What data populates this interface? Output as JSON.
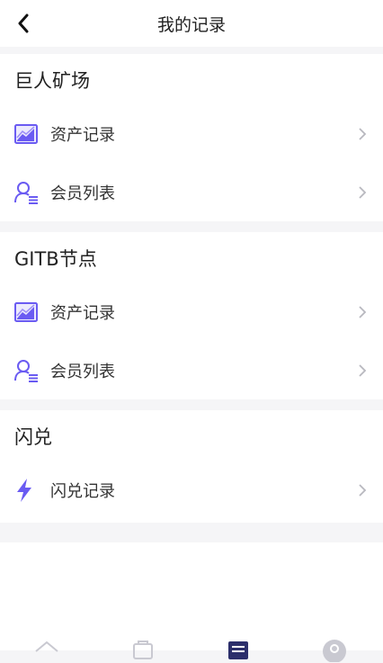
{
  "header": {
    "title": "我的记录"
  },
  "sections": [
    {
      "title": "巨人矿场",
      "items": [
        {
          "label": "资产记录",
          "icon": "chart-icon"
        },
        {
          "label": "会员列表",
          "icon": "member-list-icon"
        }
      ]
    },
    {
      "title": "GITB节点",
      "items": [
        {
          "label": "资产记录",
          "icon": "chart-icon"
        },
        {
          "label": "会员列表",
          "icon": "member-list-icon"
        }
      ]
    },
    {
      "title": "闪兑",
      "items": [
        {
          "label": "闪兑记录",
          "icon": "lightning-icon"
        }
      ]
    }
  ],
  "tabbar": {
    "tabs": [
      {
        "icon": "home-icon",
        "active": false
      },
      {
        "icon": "wallet-icon",
        "active": false
      },
      {
        "icon": "records-icon",
        "active": true
      },
      {
        "icon": "profile-icon",
        "active": false
      }
    ]
  },
  "colors": {
    "accent": "#6a5bf2",
    "accent_light": "#9a8cf7",
    "divider": "#f5f5f7",
    "tab_active": "#2c2f6b",
    "tab_inactive": "#c9c9d1"
  }
}
